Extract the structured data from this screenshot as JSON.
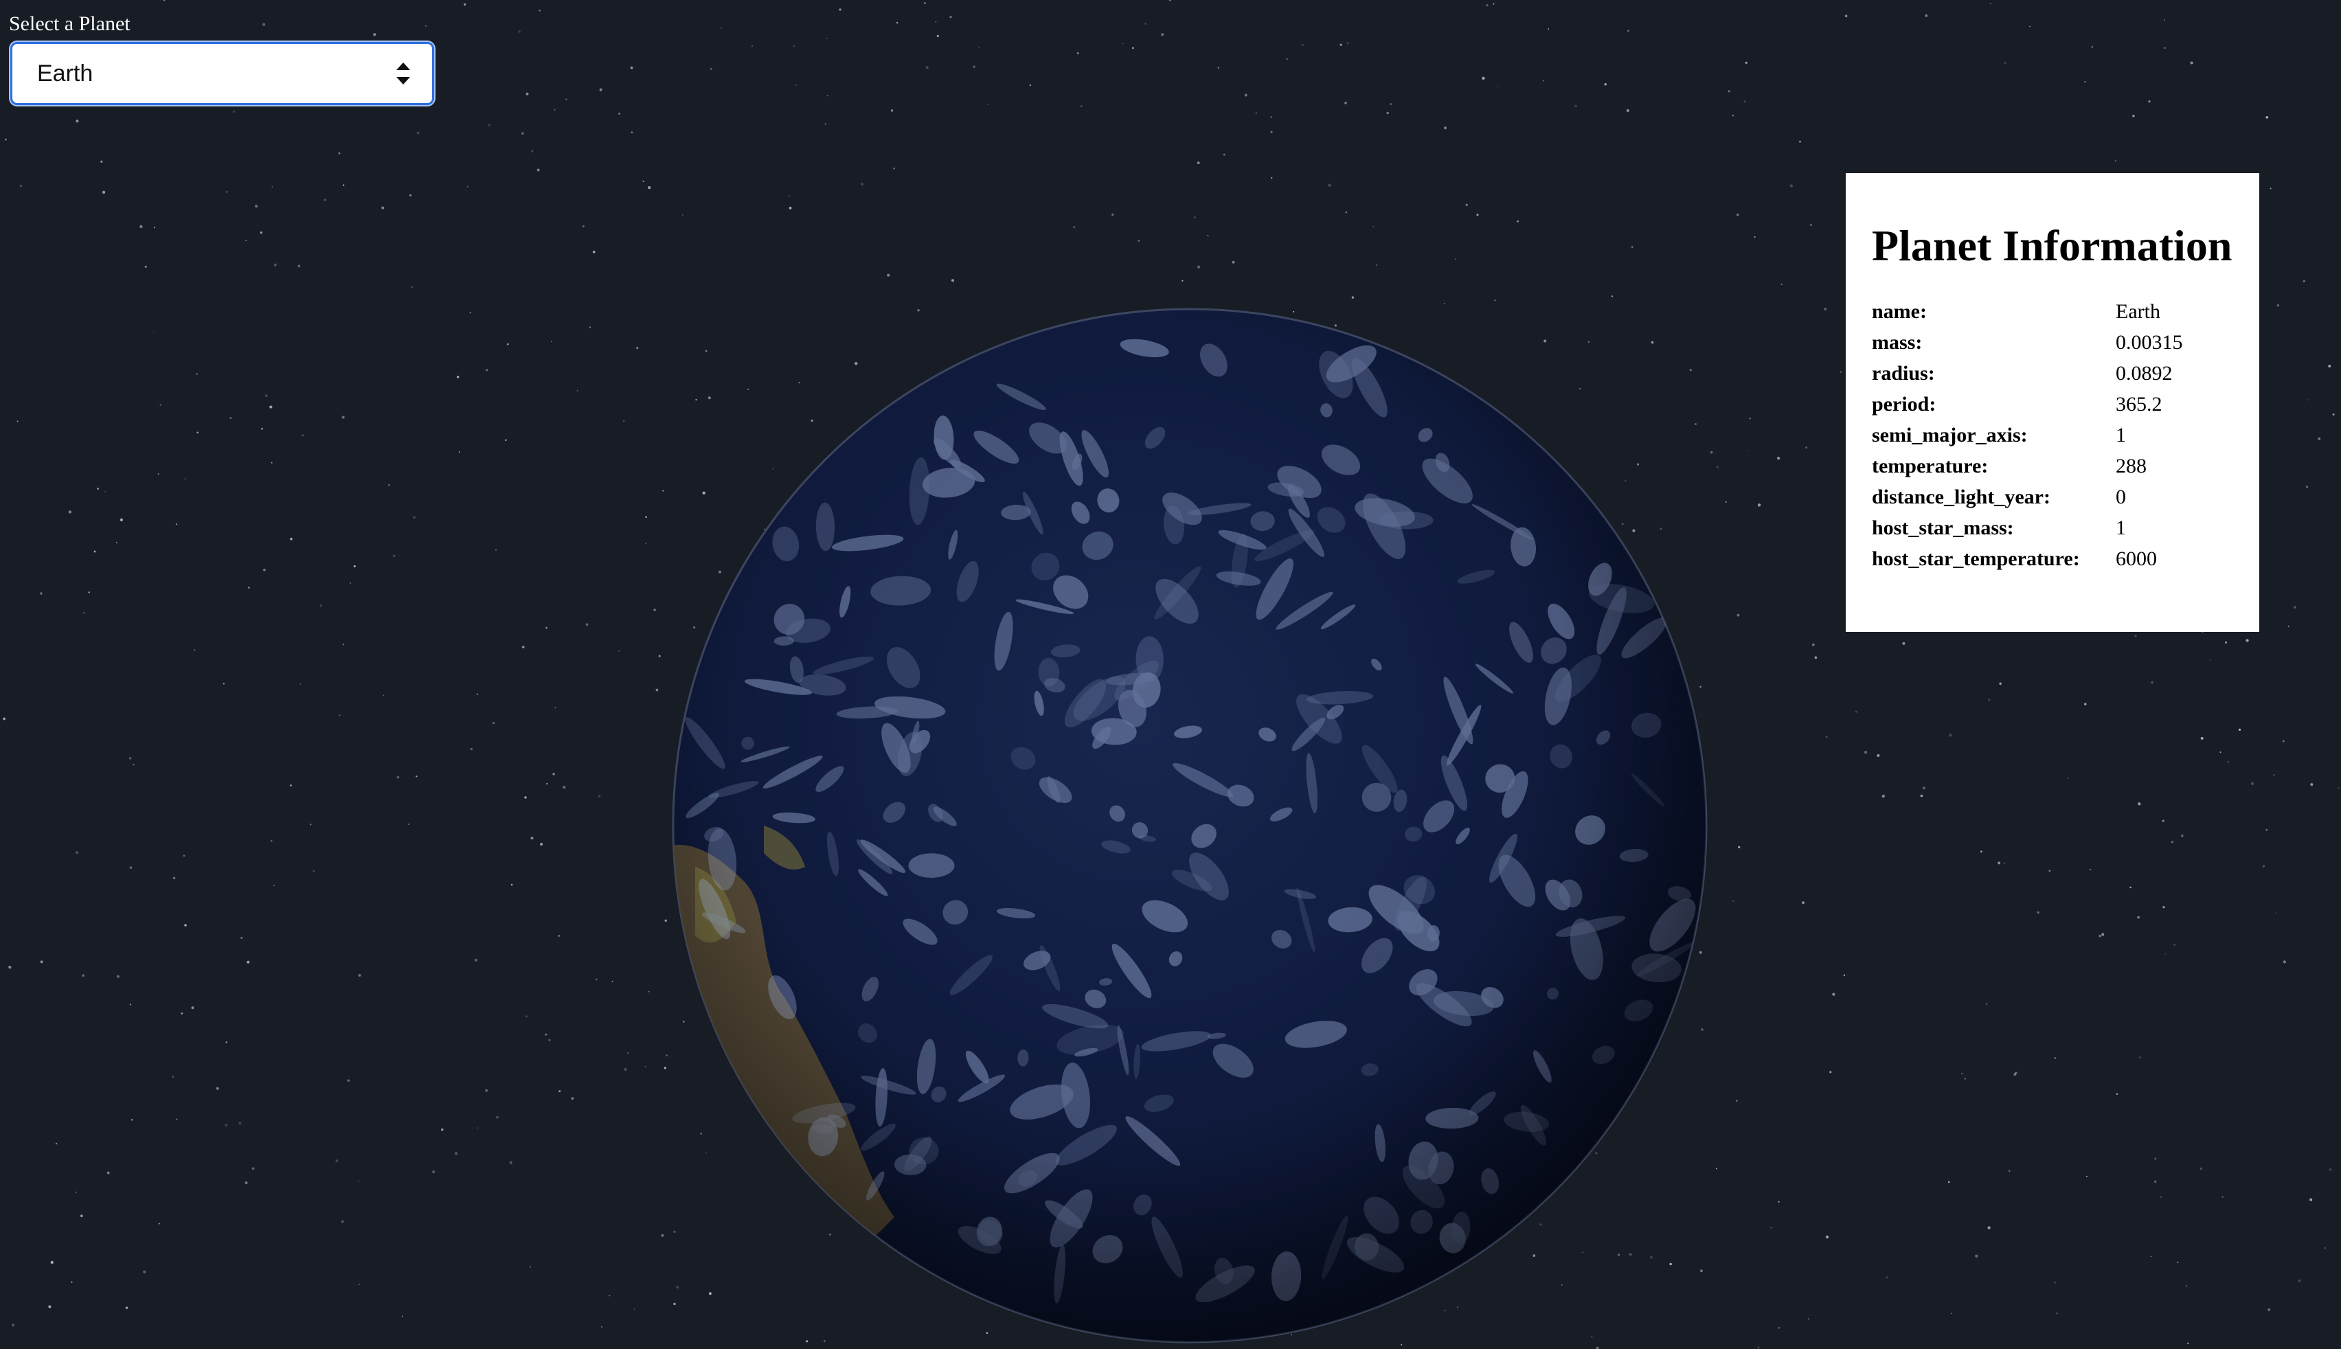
{
  "selector": {
    "label": "Select a Planet",
    "selected": "Earth"
  },
  "info_panel": {
    "title": "Planet Information",
    "rows": [
      {
        "key": "name:",
        "value": "Earth"
      },
      {
        "key": "mass:",
        "value": "0.00315"
      },
      {
        "key": "radius:",
        "value": "0.0892"
      },
      {
        "key": "period:",
        "value": "365.2"
      },
      {
        "key": "semi_major_axis:",
        "value": "1"
      },
      {
        "key": "temperature:",
        "value": "288"
      },
      {
        "key": "distance_light_year:",
        "value": "0"
      },
      {
        "key": "host_star_mass:",
        "value": "1"
      },
      {
        "key": "host_star_temperature:",
        "value": "6000"
      }
    ]
  },
  "scene": {
    "background_color": "#171c25",
    "planet_ocean_color": "#0e1a3a",
    "cloud_color": "#aab6d6",
    "land_color": "#6b5a3a"
  }
}
